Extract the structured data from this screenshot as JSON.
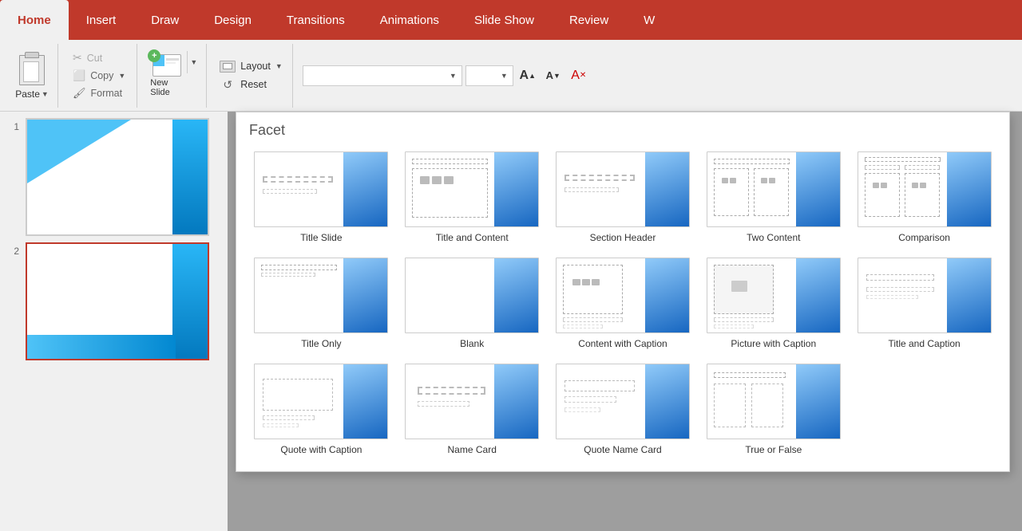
{
  "tabs": [
    {
      "label": "Home",
      "active": true
    },
    {
      "label": "Insert",
      "active": false
    },
    {
      "label": "Draw",
      "active": false
    },
    {
      "label": "Design",
      "active": false
    },
    {
      "label": "Transitions",
      "active": false
    },
    {
      "label": "Animations",
      "active": false
    },
    {
      "label": "Slide Show",
      "active": false
    },
    {
      "label": "Review",
      "active": false
    },
    {
      "label": "W",
      "active": false
    }
  ],
  "clipboard": {
    "paste_label": "Paste",
    "cut_label": "Cut",
    "copy_label": "Copy",
    "format_label": "Format"
  },
  "slide_group": {
    "new_slide_label": "New Slide"
  },
  "layout_group": {
    "layout_label": "Layout",
    "reset_label": "Reset"
  },
  "panel": {
    "title": "Facet",
    "layouts": [
      {
        "name": "Title Slide",
        "type": "title-slide"
      },
      {
        "name": "Title and Content",
        "type": "title-content"
      },
      {
        "name": "Section Header",
        "type": "section-header"
      },
      {
        "name": "Two Content",
        "type": "two-content"
      },
      {
        "name": "Comparison",
        "type": "comparison"
      },
      {
        "name": "Title Only",
        "type": "title-only"
      },
      {
        "name": "Blank",
        "type": "blank"
      },
      {
        "name": "Content with Caption",
        "type": "content-caption"
      },
      {
        "name": "Picture with Caption",
        "type": "picture-caption"
      },
      {
        "name": "Title and Caption",
        "type": "title-caption"
      },
      {
        "name": "Quote with Caption",
        "type": "quote-caption"
      },
      {
        "name": "Name Card",
        "type": "name-card"
      },
      {
        "name": "Quote Name Card",
        "type": "quote-name-card"
      },
      {
        "name": "True or False",
        "type": "true-false"
      }
    ]
  },
  "slides": [
    {
      "number": "1"
    },
    {
      "number": "2"
    }
  ],
  "font": {
    "name_placeholder": "",
    "size_placeholder": ""
  }
}
